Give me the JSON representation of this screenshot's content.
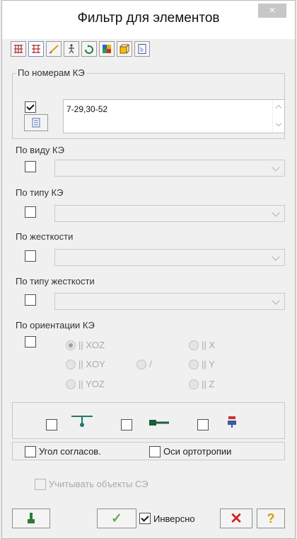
{
  "window": {
    "title": "Фильтр для элементов",
    "close_glyph": "×"
  },
  "toolbar": {
    "tabs": [
      {
        "icon": "grid-icon",
        "active": false
      },
      {
        "icon": "grid-filter-icon",
        "active": true
      },
      {
        "icon": "beam-icon",
        "active": false
      },
      {
        "icon": "figure-icon",
        "active": false
      },
      {
        "icon": "rotate-icon",
        "active": false
      },
      {
        "icon": "color-blocks-icon",
        "active": false
      },
      {
        "icon": "cube-icon",
        "active": false
      },
      {
        "icon": "document-b-icon",
        "active": false
      }
    ]
  },
  "by_numbers": {
    "label": "По номерам КЭ",
    "checked": true,
    "value": "7-29,30-52"
  },
  "by_kind": {
    "label": "По виду КЭ",
    "checked": false,
    "value": ""
  },
  "by_type": {
    "label": "По типу КЭ",
    "checked": false,
    "value": ""
  },
  "by_stiffness": {
    "label": "По жесткости",
    "checked": false,
    "value": ""
  },
  "by_stiffness_type": {
    "label": "По типу жесткости",
    "checked": false,
    "value": ""
  },
  "by_orientation": {
    "label": "По ориентации КЭ",
    "checked": false,
    "options": {
      "xoz": "|| XOZ",
      "xoy": "|| XOY",
      "yoz": "|| YOZ",
      "slash": "/",
      "x": "|| X",
      "y": "|| Y",
      "z": "|| Z"
    },
    "selected": "xoz"
  },
  "extra_filters": [
    {
      "icon": "support-icon",
      "checked": false
    },
    {
      "icon": "rigid-insert-icon",
      "checked": false
    },
    {
      "icon": "node-load-icon",
      "checked": false
    }
  ],
  "angle_label": "Угол согласов.",
  "ortho_label": "Оси ортотропии",
  "se_label": "Учитывать объекты СЭ",
  "inverse_label": "Инверсно",
  "apply_glyph": "✓",
  "cancel_glyph": "✕",
  "help_glyph": "?",
  "colors": {
    "accent": "#6aa84f",
    "cancel": "#d32222",
    "help": "#c9a400"
  }
}
